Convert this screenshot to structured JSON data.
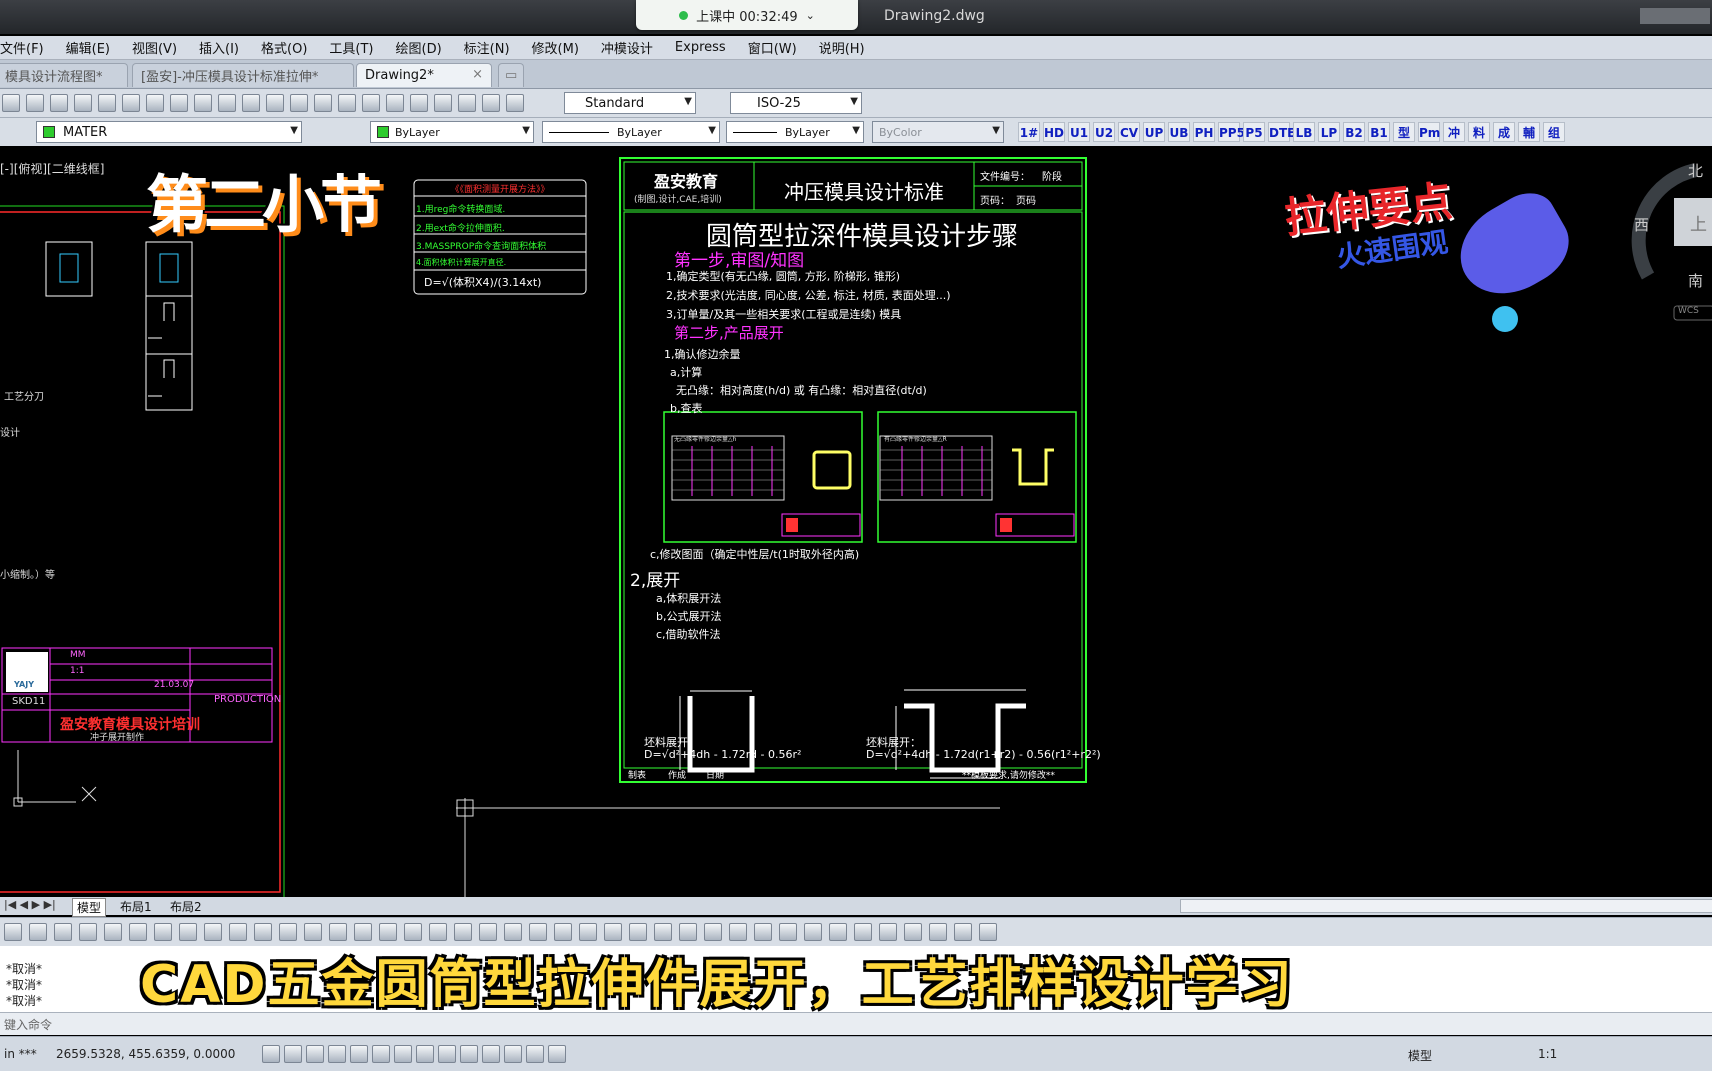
{
  "titlebar": {
    "class_status": "上课中 00:32:49",
    "document_title": "Drawing2.dwg"
  },
  "menu": [
    "文件(F)",
    "编辑(E)",
    "视图(V)",
    "插入(I)",
    "格式(O)",
    "工具(T)",
    "绘图(D)",
    "标注(N)",
    "修改(M)",
    "冲模设计",
    "Express",
    "窗口(W)",
    "说明(H)"
  ],
  "tabs": [
    {
      "label": "模具设计流程图*",
      "active": false
    },
    {
      "label": "[盈安]-冲压模具设计标准拉伸*",
      "active": false
    },
    {
      "label": "Drawing2*",
      "active": true
    }
  ],
  "toolbar": {
    "text_style": "Standard",
    "dim_style": "ISO-25",
    "layer": "MATER",
    "color": "ByLayer",
    "linetype": "ByLayer",
    "lineweight": "ByLayer",
    "plotstyle": "ByColor",
    "cad_buttons": [
      "1#",
      "HD",
      "U1",
      "U2",
      "CV",
      "UP",
      "UB",
      "PH",
      "PP5",
      "P5",
      "DTE",
      "LB",
      "LP",
      "B2",
      "B1",
      "型",
      "Pm",
      "冲",
      "料",
      "成",
      "輔",
      "组"
    ]
  },
  "overlay": {
    "section_title": "第二小节",
    "promo_line1": "拉伸要点",
    "promo_line2": "火速围观",
    "bottom_caption": "CAD五金圆筒型拉伸件展开，工艺排样设计学习"
  },
  "left_drawing": {
    "viewport_label": "[-][俯视][二维线框]",
    "side_label_1": "工艺分刀",
    "side_label_2": "设计",
    "side_label_3": "小缩制。）等",
    "titleblock_company": "盈安教育模具设计培训",
    "titleblock_sub": "冲子展开制作",
    "titleblock_production": "PRODUCTION",
    "titleblock_part": "SKD11",
    "titleblock_unit": "MM",
    "titleblock_scale": "1:1",
    "titleblock_date": "21.03.07",
    "logo_text": "YAJY"
  },
  "note_box": {
    "header": "《《面积测量开展方法》》",
    "lines": [
      "1.用reg命令转换面域.",
      "2.用ext命令拉伸面积.",
      "3.MASSPROP命令查询面积体积",
      "4.面积体积计算展开直径."
    ],
    "formula": "D=√(体积X4)/(3.14xt)"
  },
  "sheet": {
    "company": "盈安教育",
    "company_sub": "(制图,设计,CAE,培训)",
    "title": "冲压模具设计标准",
    "docno_label": "文件编号：",
    "docno_value": "阶段",
    "page_label": "页码：",
    "page_value": "页码",
    "main_title": "圆筒型拉深件模具设计步骤",
    "step1_title": "第一步,审图/知图",
    "step1_lines": [
      "1,确定类型(有无凸缘, 圆筒, 方形, 阶梯形, 锥形)",
      "2,技术要求(光洁度, 同心度, 公差, 标注, 材质, 表面处理...)",
      "3,订单量/及其一些相关要求(工程或是连续) 模具"
    ],
    "step2_title": "第二步,产品展开",
    "step2_lines": [
      "1,确认修边余量",
      "a,计算",
      "无凸缘：相对高度(h/d) 或 有凸缘：相对直径(dt/d)",
      "b,查表"
    ],
    "note_c": "c,修改图面（确定中性层/t(1时取外径内高)",
    "expand_title": "2,展开",
    "expand_lines": [
      "a,体积展开法",
      "b,公式展开法",
      "c,借助软件法"
    ],
    "formula_left_label": "坯料展开：",
    "formula_left": "D=√d²+4dh - 1.72rd - 0.56r²",
    "formula_right_label": "坯料展开：",
    "formula_right": "D=√d²+4dh - 1.72d(r1+r2) - 0.56(r1²+r2²)",
    "footer_left": [
      "制表",
      "作成",
      "日期"
    ],
    "footer_right": "**模板要求,请勿修改**",
    "table1_title": "无凸缘零件修边余量△h",
    "table2_title": "有凸缘零件修边余量△R"
  },
  "viewcube": {
    "north": "北",
    "west": "西",
    "south": "南",
    "top": "上",
    "wcs": "WCS"
  },
  "layout_tabs": [
    "模型",
    "布局1",
    "布局2"
  ],
  "command_history": [
    "*取消*",
    "*取消*",
    "*取消*"
  ],
  "command_prompt": "键入命令",
  "status": {
    "coords": "2659.5328, 455.6359, 0.0000",
    "space": "模型",
    "scale": "1:1",
    "prefix": "in ***"
  },
  "colors": {
    "sheet_border": "#33ff33",
    "magenta": "#ff33ff",
    "accent_red": "#e8262a",
    "caption_yellow": "#ffd83c"
  }
}
